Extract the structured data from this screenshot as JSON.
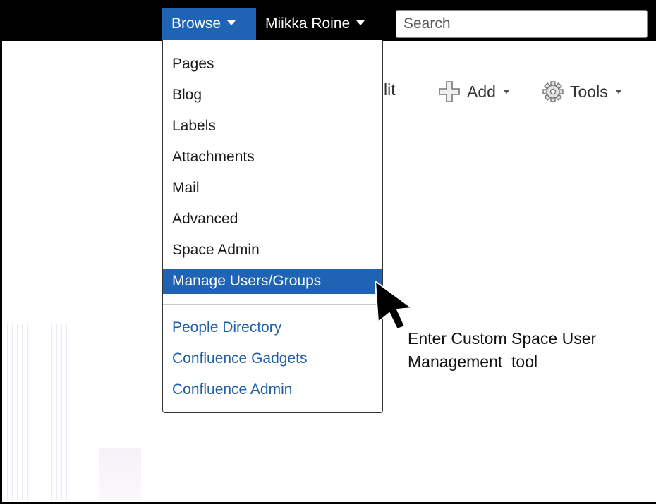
{
  "topbar": {
    "browse_label": "Browse",
    "user_label": "Miikka Roine",
    "search_placeholder": "Search"
  },
  "toolbar": {
    "edit_fragment": "lit",
    "add_label": "Add",
    "tools_label": "Tools"
  },
  "menu": {
    "items": [
      "Pages",
      "Blog",
      "Labels",
      "Attachments",
      "Mail",
      "Advanced",
      "Space Admin",
      "Manage Users/Groups",
      "People Directory",
      "Confluence Gadgets",
      "Confluence Admin"
    ]
  },
  "annotation": {
    "line1": "Enter Custom Space User",
    "line2": "Management  tool"
  },
  "colors": {
    "accent": "#1f63b5",
    "link": "#1f5fa8",
    "topbar": "#000000"
  }
}
